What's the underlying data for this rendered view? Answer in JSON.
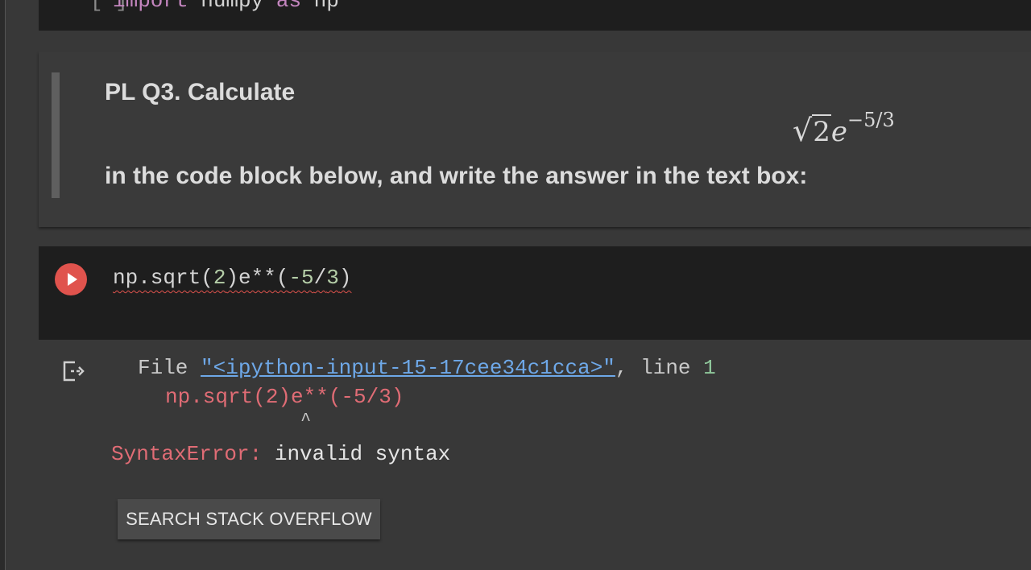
{
  "top_cell": {
    "bracket": "[ ]",
    "keyword_import": "import",
    "module": " numpy ",
    "keyword_as": "as",
    "alias": " np"
  },
  "markdown_cell": {
    "title": "PL Q3. Calculate",
    "math": {
      "radicand": "2",
      "base": "e",
      "exponent": "−5/3"
    },
    "body": "in the code block below, and write the answer in the text box:"
  },
  "code_cell": {
    "code_part1": "np.sqrt(",
    "code_num1": "2",
    "code_part2": ")e**(",
    "code_num2": "-5",
    "code_part3": "/",
    "code_num3": "3",
    "code_part4": ")"
  },
  "output": {
    "file_label": "File ",
    "file_link": "\"<ipython-input-15-17cee34c1cca>\"",
    "line_label": ", line ",
    "line_number": "1",
    "code_echo": "np.sqrt(2)e**(-5/3)",
    "caret": "^",
    "error_name": "SyntaxError:",
    "error_message": " invalid syntax",
    "search_button": "SEARCH STACK OVERFLOW"
  },
  "colors": {
    "run_button": "#e0534d",
    "error_text": "#e06c75",
    "link": "#6ea8e8",
    "keyword": "#c586c0",
    "number": "#b5cea8"
  }
}
